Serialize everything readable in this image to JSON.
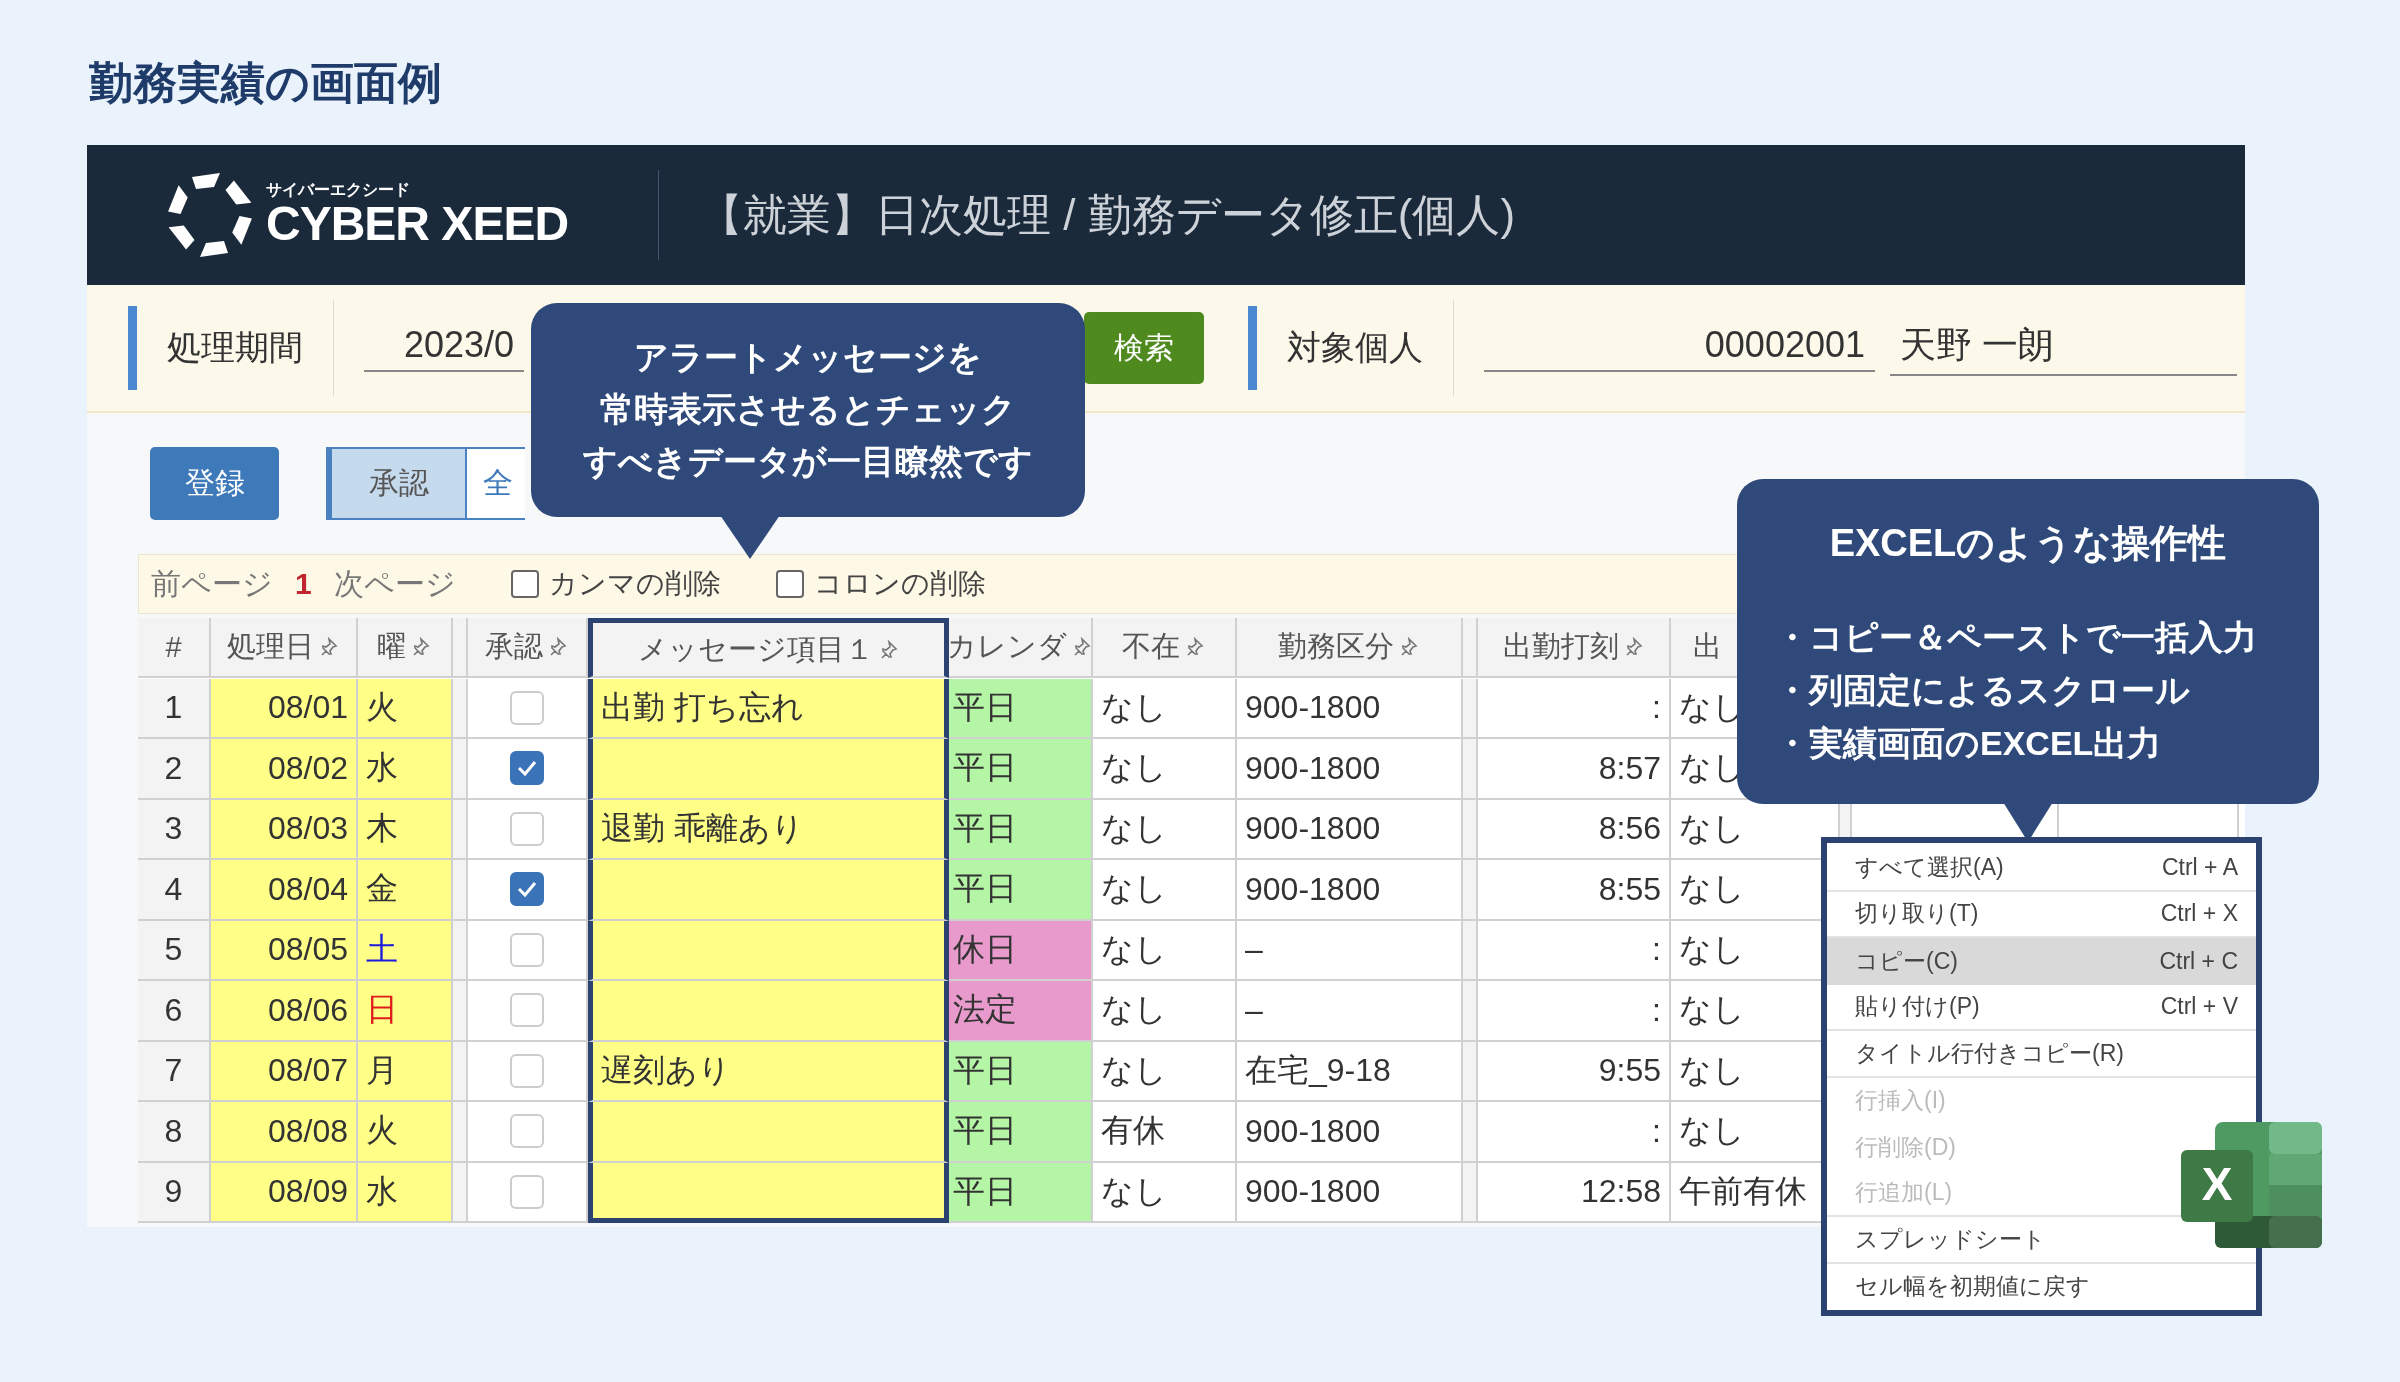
{
  "page_title": "勤務実績の画面例",
  "app": {
    "logo_kana": "サイバーエクシード",
    "logo_name": "CYBER XEED",
    "title": "【就業】日次処理 / 勤務データ修正(個人)"
  },
  "filter": {
    "period_label": "処理期間",
    "period_value": "2023/0",
    "search_button": "検索",
    "person_label": "対象個人",
    "person_id": "00002001",
    "person_name": "天野 一朗"
  },
  "toolbar": {
    "register_button": "登録",
    "tabs": [
      {
        "label": "承認",
        "selected": true
      },
      {
        "label": "全",
        "selected": false
      }
    ]
  },
  "pager": {
    "prev": "前ページ",
    "page": "1",
    "next": "次ページ",
    "options": [
      {
        "label": "カンマの削除",
        "checked": false
      },
      {
        "label": "コロンの削除",
        "checked": false
      }
    ]
  },
  "table": {
    "columns": [
      {
        "kind": "text",
        "label": "#",
        "pinned": false
      },
      {
        "kind": "text",
        "label": "処理日",
        "pinned": true
      },
      {
        "kind": "text",
        "label": "曜",
        "pinned": true
      },
      {
        "kind": "separator"
      },
      {
        "kind": "text",
        "label": "承認",
        "pinned": true
      },
      {
        "kind": "text",
        "label": "メッセージ項目１",
        "pinned": true
      },
      {
        "kind": "text",
        "label": "カレンダ",
        "pinned": true
      },
      {
        "kind": "text",
        "label": "不在",
        "pinned": true
      },
      {
        "kind": "text",
        "label": "勤務区分",
        "pinned": true
      },
      {
        "kind": "separator"
      },
      {
        "kind": "text",
        "label": "出勤打刻",
        "pinned": true
      },
      {
        "kind": "text",
        "label": "出",
        "pinned": false
      },
      {
        "kind": "separator"
      },
      {
        "kind": "text"
      },
      {
        "kind": "text"
      }
    ],
    "rows": [
      {
        "no": "1",
        "date": "08/01",
        "day": {
          "text": "火",
          "color": "#333333"
        },
        "approved": false,
        "message": "出勤 打ち忘れ",
        "calendar": {
          "text": "平日",
          "color": "#b5f5a6"
        },
        "absence": "なし",
        "shift": "900-1800",
        "clock_in": ":",
        "column_12": "なし"
      },
      {
        "no": "2",
        "date": "08/02",
        "day": {
          "text": "水",
          "color": "#333333"
        },
        "approved": true,
        "calendar": {
          "text": "平日",
          "color": "#b5f5a6"
        },
        "absence": "なし",
        "shift": "900-1800",
        "clock_in": "8:57",
        "column_12": "なし"
      },
      {
        "no": "3",
        "date": "08/03",
        "day": {
          "text": "木",
          "color": "#333333"
        },
        "approved": false,
        "message": "退勤 乖離あり",
        "calendar": {
          "text": "平日",
          "color": "#b5f5a6"
        },
        "absence": "なし",
        "shift": "900-1800",
        "clock_in": "8:56",
        "column_12": "なし"
      },
      {
        "no": "4",
        "date": "08/04",
        "day": {
          "text": "金",
          "color": "#333333"
        },
        "approved": true,
        "calendar": {
          "text": "平日",
          "color": "#b5f5a6"
        },
        "absence": "なし",
        "shift": "900-1800",
        "clock_in": "8:55",
        "column_12": "なし"
      },
      {
        "no": "5",
        "date": "08/05",
        "day": {
          "text": "土",
          "color": "#1a1adc"
        },
        "approved": false,
        "calendar": {
          "text": "休日",
          "color": "#e79acb"
        },
        "absence": "なし",
        "shift": "–",
        "clock_in": ":",
        "column_12": "なし"
      },
      {
        "no": "6",
        "date": "08/06",
        "day": {
          "text": "日",
          "color": "#e01b1b"
        },
        "approved": false,
        "calendar": {
          "text": "法定",
          "color": "#e79acb"
        },
        "absence": "なし",
        "shift": "–",
        "clock_in": ":",
        "column_12": "なし"
      },
      {
        "no": "7",
        "date": "08/07",
        "day": {
          "text": "月",
          "color": "#333333"
        },
        "approved": false,
        "message": "遅刻あり",
        "calendar": {
          "text": "平日",
          "color": "#b5f5a6"
        },
        "absence": "なし",
        "shift": "在宅_9-18",
        "clock_in": "9:55",
        "column_12": "なし"
      },
      {
        "no": "8",
        "date": "08/08",
        "day": {
          "text": "火",
          "color": "#333333"
        },
        "approved": false,
        "calendar": {
          "text": "平日",
          "color": "#b5f5a6"
        },
        "absence": "有休",
        "shift": "900-1800",
        "clock_in": ":",
        "column_12": "なし"
      },
      {
        "no": "9",
        "date": "08/09",
        "day": {
          "text": "水",
          "color": "#333333"
        },
        "approved": false,
        "calendar": {
          "text": "平日",
          "color": "#b5f5a6"
        },
        "absence": "なし",
        "shift": "900-1800",
        "clock_in": "12:58",
        "column_12": "午前有休"
      }
    ]
  },
  "callout_alert": {
    "lines": [
      "アラートメッセージを",
      "常時表示させるとチェック",
      "すべきデータが一目瞭然です"
    ]
  },
  "callout_excel": {
    "title": "EXCELのような操作性",
    "bullets": [
      "・コピー＆ペーストで一括入力",
      "・列固定によるスクロール",
      "・実績画面のEXCEL出力"
    ]
  },
  "context_menu": {
    "items": [
      {
        "label": "すべて選択(A)",
        "shortcut": "Ctrl + A",
        "disabled": false,
        "selected": false,
        "divider": true
      },
      {
        "label": "切り取り(T)",
        "shortcut": "Ctrl + X",
        "disabled": false,
        "selected": false,
        "divider": true
      },
      {
        "label": "コピー(C)",
        "shortcut": "Ctrl + C",
        "disabled": false,
        "selected": true,
        "divider": false
      },
      {
        "label": "貼り付け(P)",
        "shortcut": "Ctrl + V",
        "disabled": false,
        "selected": false,
        "divider": true
      },
      {
        "label": "タイトル行付きコピー(R)",
        "disabled": false,
        "selected": false,
        "divider": true
      },
      {
        "label": "行挿入(I)",
        "disabled": true,
        "selected": false,
        "divider": false
      },
      {
        "label": "行削除(D)",
        "disabled": true,
        "selected": false,
        "divider": false
      },
      {
        "label": "行追加(L)",
        "disabled": true,
        "selected": false,
        "divider": true
      },
      {
        "label": "スプレッドシート",
        "disabled": false,
        "selected": false,
        "divider": true
      },
      {
        "label": "セル幅を初期値に戻す",
        "disabled": false,
        "selected": false,
        "divider": false
      }
    ]
  },
  "app_badge": {
    "letter": "X"
  }
}
